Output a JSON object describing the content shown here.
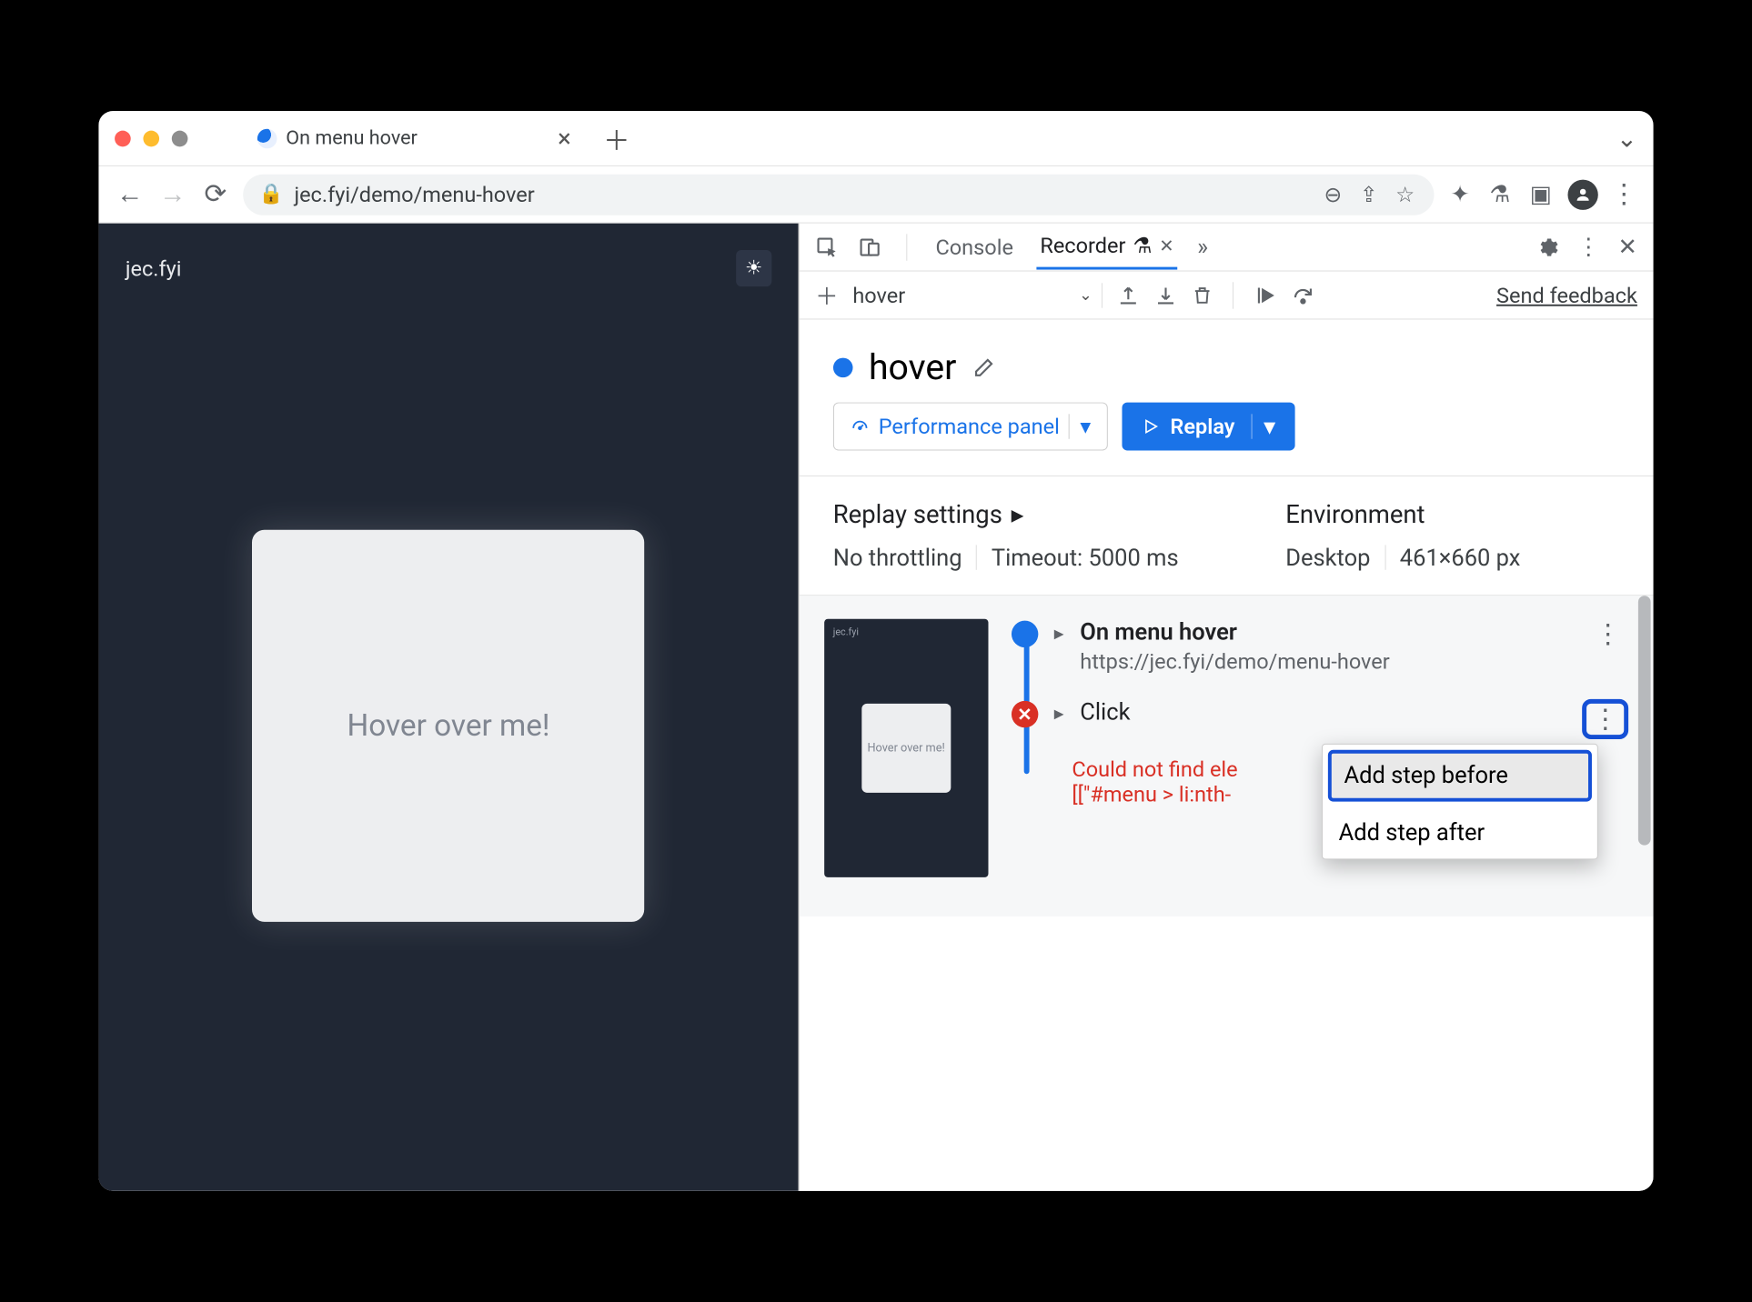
{
  "browser": {
    "tab_title": "On menu hover",
    "url": "jec.fyi/demo/menu-hover"
  },
  "page": {
    "brand": "jec.fyi",
    "card_text": "Hover over me!"
  },
  "devtools": {
    "tabs": {
      "console": "Console",
      "recorder": "Recorder"
    },
    "toolbar": {
      "select_value": "hover",
      "send_feedback": "Send feedback"
    },
    "recording": {
      "title": "hover",
      "perf_btn": "Performance panel",
      "replay_btn": "Replay"
    },
    "settings": {
      "replay_head": "Replay settings",
      "throttling": "No throttling",
      "timeout": "Timeout: 5000 ms",
      "env_head": "Environment",
      "device": "Desktop",
      "size": "461×660 px"
    },
    "steps": {
      "thumb_brand": "jec.fyi",
      "thumb_text": "Hover over me!",
      "step1_title": "On menu hover",
      "step1_url": "https://jec.fyi/demo/menu-hover",
      "step2_title": "Click",
      "error_l1": "Could not find ele",
      "error_l2": "[[\"#menu > li:nth-"
    },
    "context_menu": {
      "before": "Add step before",
      "after": "Add step after"
    }
  }
}
